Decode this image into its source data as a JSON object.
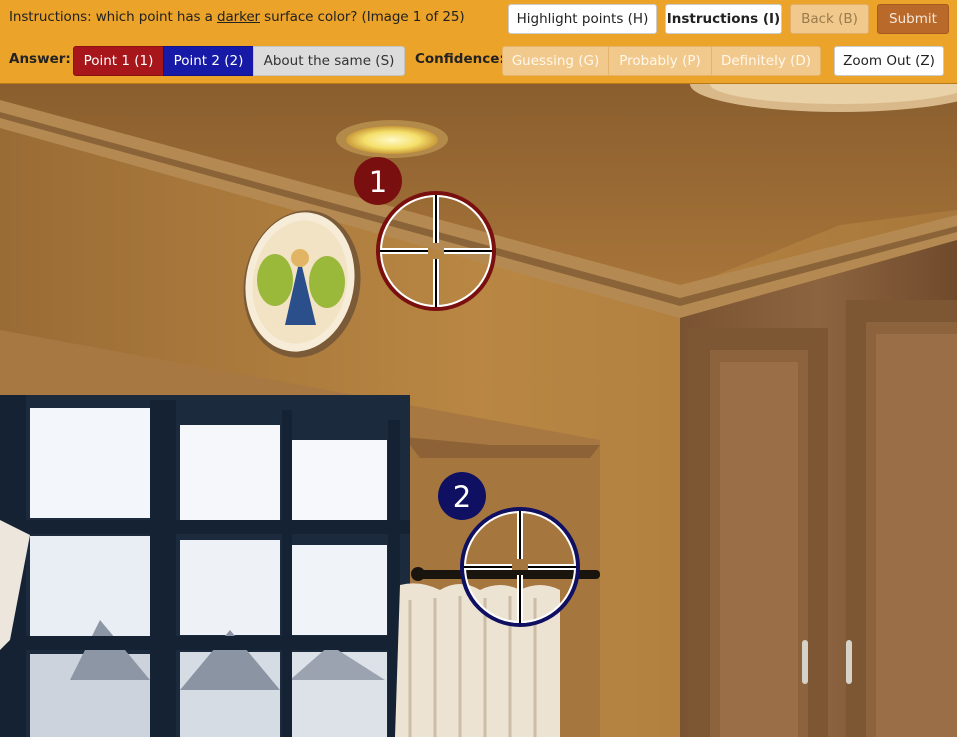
{
  "header": {
    "instructions_prefix": "Instructions: which point has a ",
    "instructions_emphasis": "darker",
    "instructions_suffix": " surface color? (Image 1 of 25)"
  },
  "toolbar": {
    "highlight_label": "Highlight points (H)",
    "instructions_label": "Instructions (I)",
    "back_label": "Back (B)",
    "submit_label": "Submit",
    "zoom_out_label": "Zoom Out (Z)"
  },
  "answer": {
    "label": "Answer:",
    "options": [
      "Point 1 (1)",
      "Point 2 (2)",
      "About the same (S)"
    ]
  },
  "confidence": {
    "label": "Confidence:",
    "options": [
      "Guessing (G)",
      "Probably (P)",
      "Definitely (D)"
    ]
  },
  "points": [
    {
      "number": "1",
      "color": "#7a0f0f"
    },
    {
      "number": "2",
      "color": "#101063"
    }
  ],
  "colors": {
    "toolbar_bg": "#eba32a",
    "point1": "#a6161a",
    "point2": "#161aa6",
    "submit": "#b9692a"
  }
}
